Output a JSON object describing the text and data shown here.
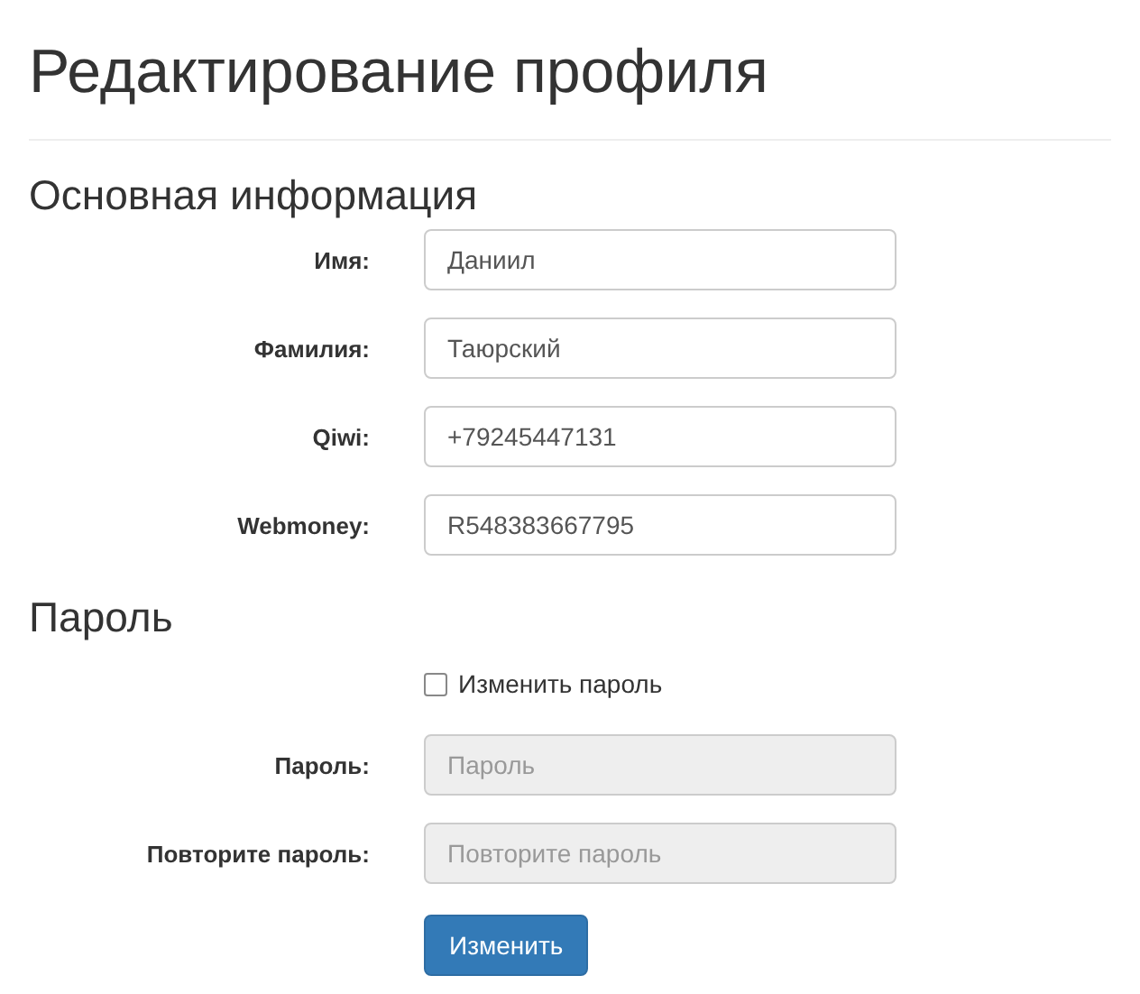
{
  "title": "Редактирование профиля",
  "main_section": {
    "heading": "Основная информация",
    "fields": [
      {
        "label": "Имя:",
        "value": "Даниил"
      },
      {
        "label": "Фамилия:",
        "value": "Таюрский"
      },
      {
        "label": "Qiwi:",
        "value": "+79245447131"
      },
      {
        "label": "Webmoney:",
        "value": "R548383667795"
      }
    ]
  },
  "password_section": {
    "heading": "Пароль",
    "change_password": {
      "label": "Изменить пароль",
      "checked": false
    },
    "fields": [
      {
        "label": "Пароль:",
        "placeholder": "Пароль",
        "disabled": true
      },
      {
        "label": "Повторите пароль:",
        "placeholder": "Повторите пароль",
        "disabled": true
      }
    ]
  },
  "submit_button": "Изменить"
}
